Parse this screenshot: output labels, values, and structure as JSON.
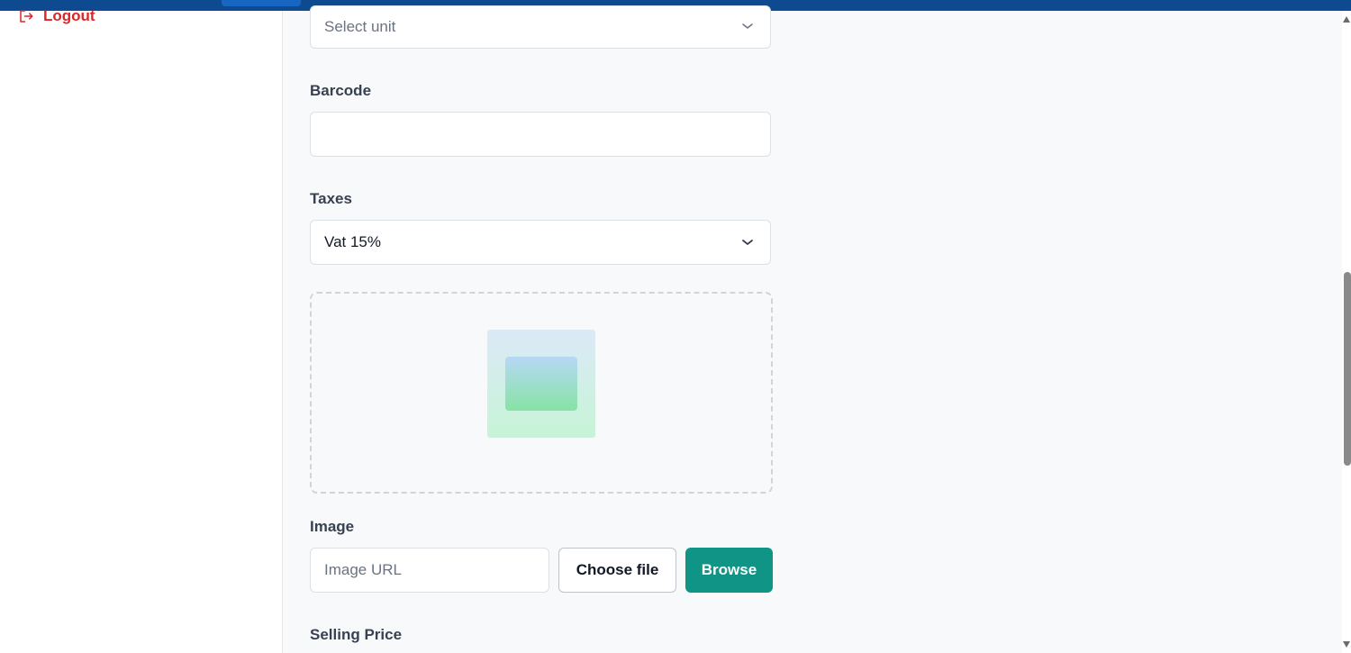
{
  "sidebar": {
    "logout_label": "Logout",
    "logout_icon": "logout-icon"
  },
  "form": {
    "unit": {
      "placeholder": "Select unit"
    },
    "barcode": {
      "label": "Barcode",
      "value": ""
    },
    "taxes": {
      "label": "Taxes",
      "selected": "Vat 15%"
    },
    "image": {
      "label": "Image",
      "url_placeholder": "Image URL",
      "choose_file_label": "Choose file",
      "browse_label": "Browse"
    },
    "selling_price": {
      "label": "Selling Price"
    }
  },
  "colors": {
    "topbar": "#0d4a8f",
    "danger": "#dc2626",
    "primary": "#0f9486"
  }
}
